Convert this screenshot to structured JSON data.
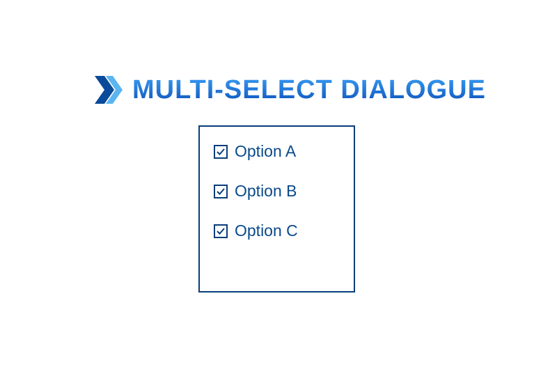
{
  "header": {
    "title": "MULTI-SELECT DIALOGUE"
  },
  "options": [
    {
      "label": "Option A",
      "checked": true
    },
    {
      "label": "Option B",
      "checked": true
    },
    {
      "label": "Option C",
      "checked": true
    }
  ]
}
